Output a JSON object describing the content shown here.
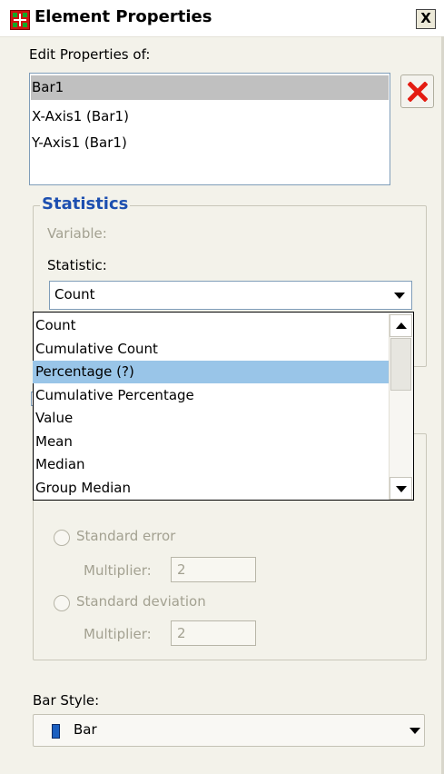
{
  "window": {
    "title": "Element Properties",
    "close_label": "X"
  },
  "edit_properties": {
    "label": "Edit Properties of:",
    "items": [
      {
        "label": "Bar1",
        "selected": true
      },
      {
        "label": "X-Axis1 (Bar1)",
        "selected": false
      },
      {
        "label": "Y-Axis1 (Bar1)",
        "selected": false
      }
    ]
  },
  "statistics": {
    "title": "Statistics",
    "variable_label": "Variable:",
    "statistic_label": "Statistic:",
    "statistic_value": "Count",
    "options": [
      {
        "label": "Count",
        "highlighted": false
      },
      {
        "label": "Cumulative Count",
        "highlighted": false
      },
      {
        "label": "Percentage (?)",
        "highlighted": true
      },
      {
        "label": "Cumulative Percentage",
        "highlighted": false
      },
      {
        "label": "Value",
        "highlighted": false
      },
      {
        "label": "Mean",
        "highlighted": false
      },
      {
        "label": "Median",
        "highlighted": false
      },
      {
        "label": "Group Median",
        "highlighted": false
      }
    ]
  },
  "error_bars": {
    "standard_error_label": "Standard error",
    "standard_error_multiplier_label": "Multiplier:",
    "standard_error_multiplier": "2",
    "standard_deviation_label": "Standard deviation",
    "standard_deviation_multiplier_label": "Multiplier:",
    "standard_deviation_multiplier": "2"
  },
  "bar_style": {
    "label": "Bar Style:",
    "value": "Bar"
  },
  "colors": {
    "title_blue": "#1d4fb0",
    "highlight": "#99c5e8",
    "bar_swatch": "#1b5fc0"
  }
}
